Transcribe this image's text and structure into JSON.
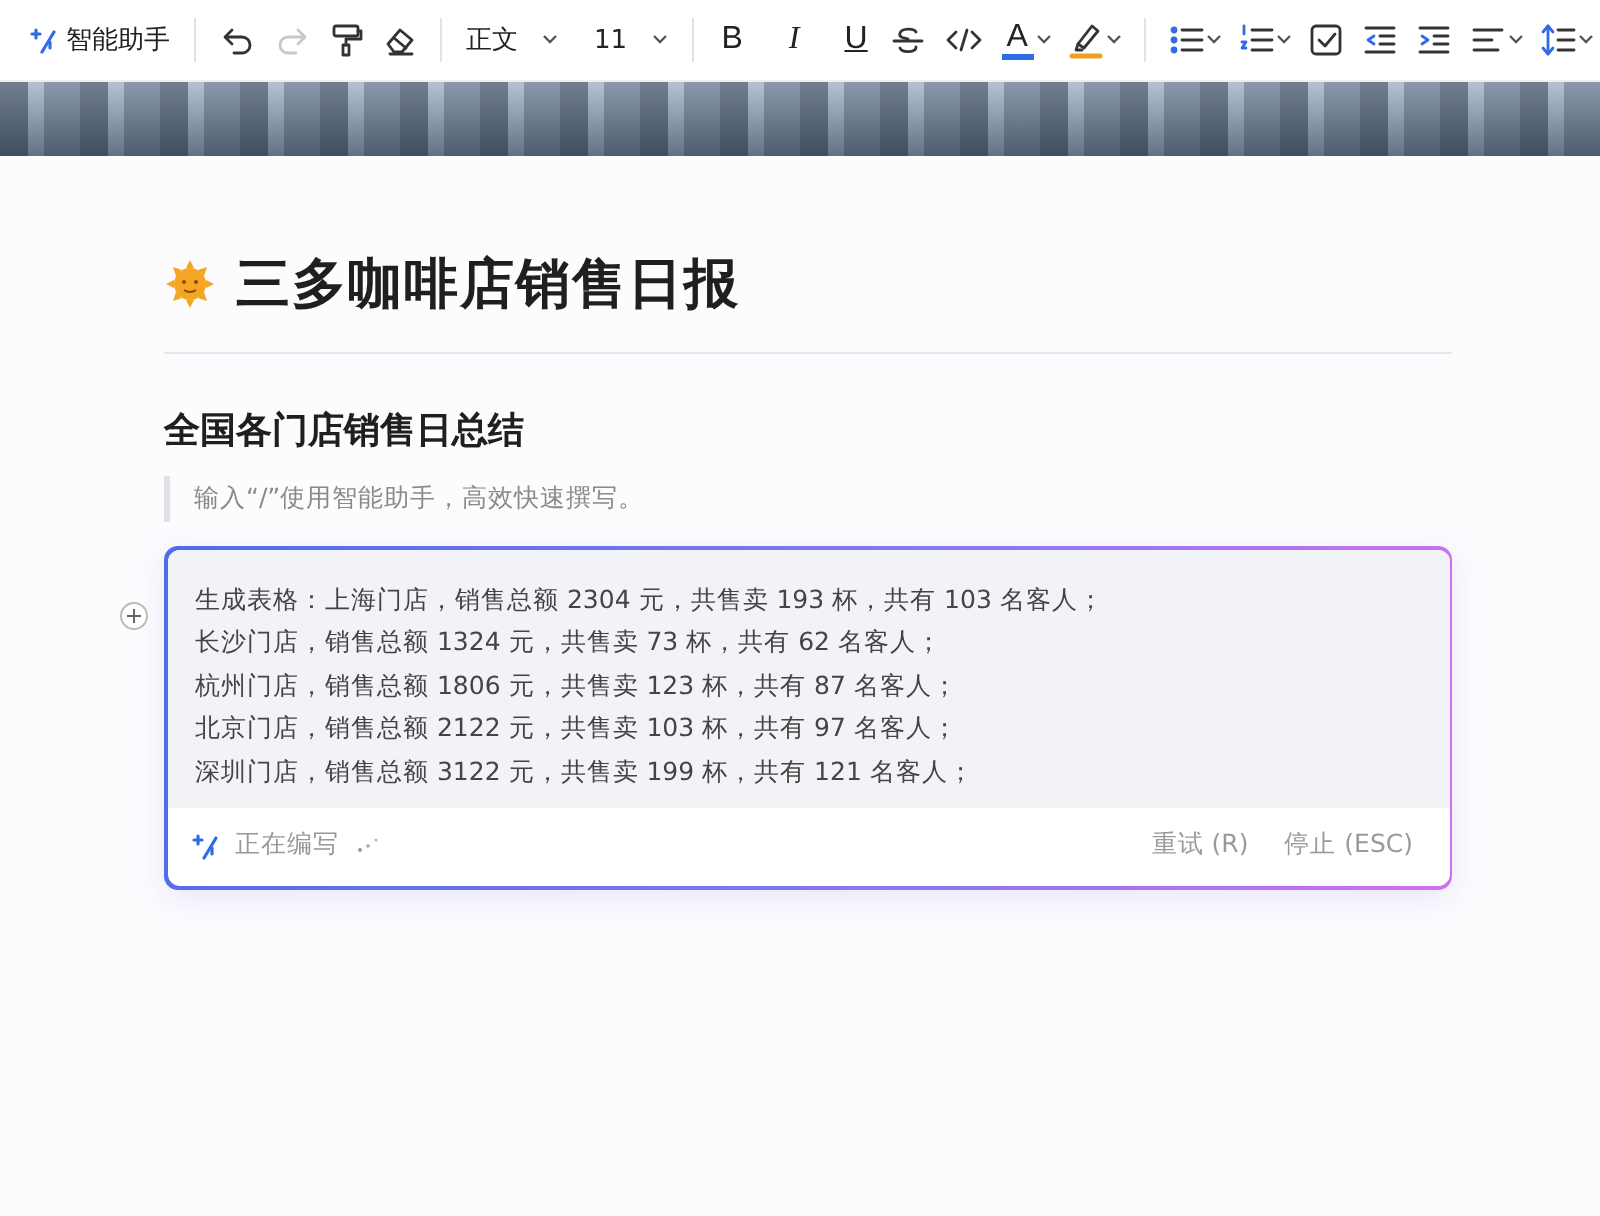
{
  "toolbar": {
    "ai_button": "智能助手",
    "undo": {
      "disabled": false
    },
    "redo": {
      "disabled": true
    },
    "style_dropdown": "正文",
    "size_dropdown": "11",
    "bold": "B",
    "italic": "I",
    "underline": "U",
    "font_color": "A"
  },
  "document": {
    "title": "三多咖啡店销售日报",
    "heading": "全国各门店销售日总结",
    "hint": "输入“/”使用智能助手，高效快速撰写。"
  },
  "ai_panel": {
    "lines": [
      "生成表格：上海门店，销售总额 2304 元，共售卖 193 杯，共有 103 名客人；",
      "长沙门店，销售总额 1324 元，共售卖 73 杯，共有 62 名客人；",
      "杭州门店，销售总额 1806 元，共售卖 123 杯，共有 87 名客人；",
      "北京门店，销售总额 2122 元，共售卖 103 杯，共有 97 名客人；",
      "深圳门店，销售总额 3122 元，共售卖 199 杯，共有 121 名客人；"
    ],
    "status": "正在编写",
    "retry_button": "重试 (R)",
    "stop_button": "停止 (ESC)"
  }
}
